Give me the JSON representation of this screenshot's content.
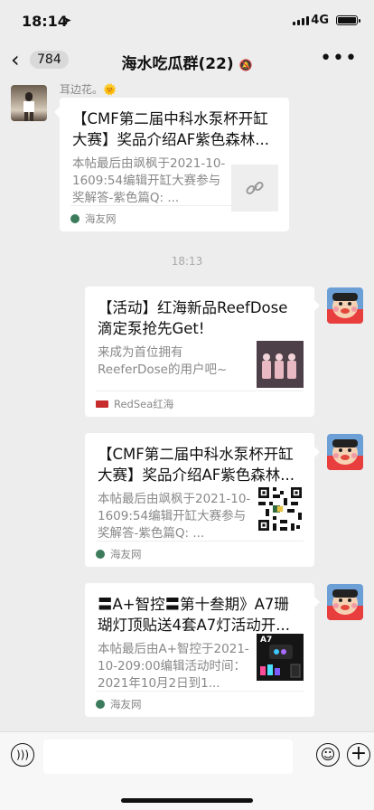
{
  "status_bar": {
    "time": "18:14",
    "location_icon": "arrow-icon",
    "network": "4G"
  },
  "nav": {
    "back_icon": "chevron-left-icon",
    "unread_count": "784",
    "title": "海水吃瓜群(22)",
    "mute_icon": "bell-off-icon",
    "more_icon": "more-icon"
  },
  "messages": [
    {
      "sender": "other",
      "partial_text": "耳边花。🌞",
      "card": {
        "title": "【CMF第二届中科水泵杯开缸大赛】奖品介绍AF紫色森林...",
        "desc": "本帖最后由飒枫于2021-10-1609:54编辑开缸大赛参与奖解答-紫色篇Q: ...",
        "thumb": "link-icon",
        "source": "海友网"
      }
    }
  ],
  "time_separator": "18:13",
  "my_messages": [
    {
      "card": {
        "title": "【活动】红海新品ReefDose滴定泵抢先Get!",
        "desc": "来成为首位拥有ReeferDose的用户吧~",
        "thumb": "product-photo",
        "source": "RedSea红海"
      }
    },
    {
      "card": {
        "title": "【CMF第二届中科水泵杯开缸大赛】奖品介绍AF紫色森林...",
        "desc": "本帖最后由飒枫于2021-10-1609:54编辑开缸大赛参与奖解答-紫色篇Q: ...",
        "thumb": "qr-code",
        "source": "海友网"
      }
    },
    {
      "card": {
        "title": "〓A+智控〓第十叁期》A7珊瑚灯顶贴送4套A7灯活动开...",
        "desc": "本帖最后由A+智控于2021-10-209:00编辑活动时间：2021年10月2日到1...",
        "thumb": "a7-product",
        "thumb_label": "A7",
        "source": "海友网"
      }
    }
  ],
  "input_bar": {
    "voice_icon": "voice-icon",
    "emoji_icon": "emoji-icon",
    "plus_icon": "plus-icon"
  }
}
